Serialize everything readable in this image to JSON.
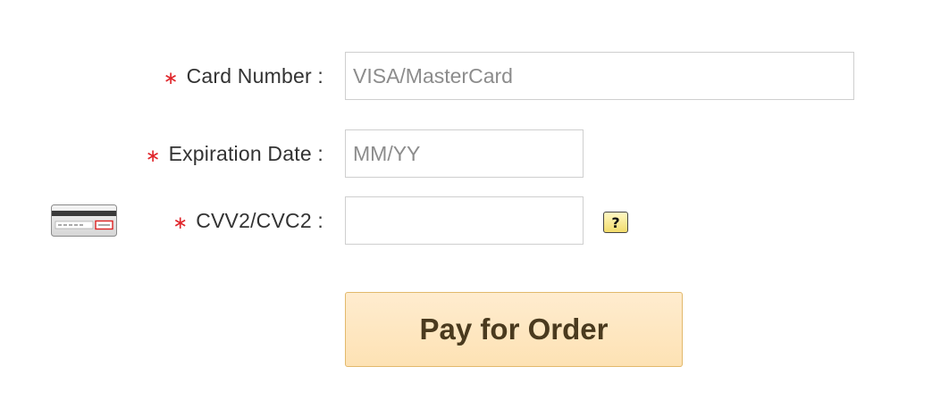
{
  "form": {
    "required_marker": "∗",
    "card_number": {
      "label": "Card Number :",
      "placeholder": "VISA/MasterCard",
      "value": ""
    },
    "expiration_date": {
      "label": "Expiration Date :",
      "placeholder": "MM/YY",
      "value": ""
    },
    "cvv": {
      "label": "CVV2/CVC2 :",
      "placeholder": "",
      "value": ""
    },
    "help_icon_label": "?",
    "submit_label": "Pay for Order"
  },
  "colors": {
    "required": "#e0262b",
    "button_bg": "#fde6bd",
    "button_border": "#e2b96c",
    "button_text": "#4a3a1e",
    "help_bg": "#f8e891",
    "input_border": "#cfcfcf",
    "placeholder": "#8c8c8c"
  },
  "icons": {
    "card": "credit-card-back-icon",
    "help": "question-mark-icon"
  }
}
